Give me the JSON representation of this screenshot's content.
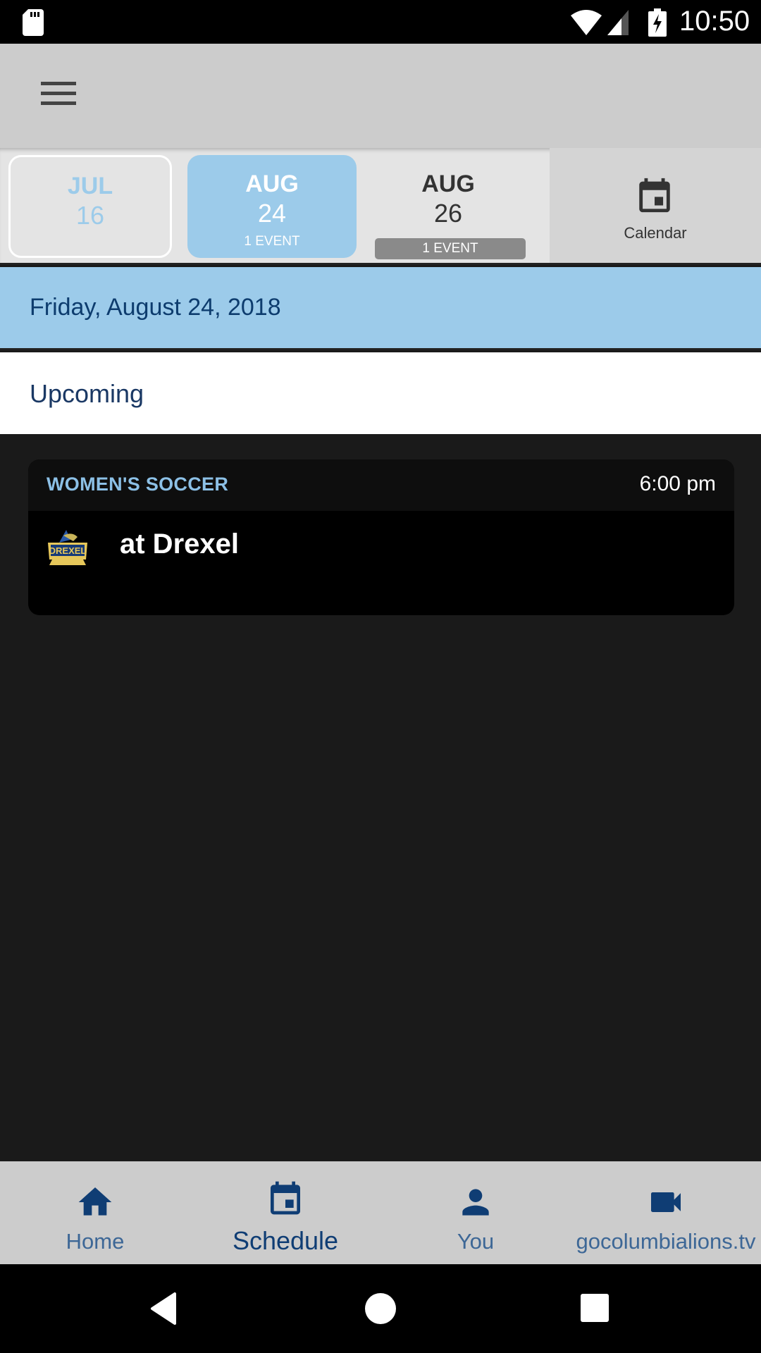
{
  "status_bar": {
    "time": "10:50",
    "icons": [
      "sd-card-icon",
      "wifi-icon",
      "cell-signal-icon",
      "battery-charging-icon"
    ]
  },
  "app_bar": {
    "menu_icon": "hamburger-menu-icon"
  },
  "date_strip": {
    "dates": [
      {
        "month": "JUL",
        "day": "16",
        "events": "",
        "state": "outlined"
      },
      {
        "month": "AUG",
        "day": "24",
        "events": "1 EVENT",
        "state": "selected"
      },
      {
        "month": "AUG",
        "day": "26",
        "events": "1 EVENT",
        "state": "default"
      }
    ],
    "calendar_label": "Calendar",
    "calendar_icon": "calendar-icon"
  },
  "date_header": "Friday, August 24, 2018",
  "section_label": "Upcoming",
  "events": [
    {
      "sport": "WOMEN'S SOCCER",
      "time": "6:00 pm",
      "opponent": "at Drexel",
      "logo": "drexel-dragons-logo"
    }
  ],
  "bottom_nav": {
    "items": [
      {
        "label": "Home",
        "icon": "home-icon",
        "active": false
      },
      {
        "label": "Schedule",
        "icon": "calendar-icon",
        "active": true
      },
      {
        "label": "You",
        "icon": "person-icon",
        "active": false
      },
      {
        "label": "gocolumbialions.tv",
        "icon": "video-camera-icon",
        "active": false
      }
    ]
  },
  "colors": {
    "accent_light_blue": "#9ccbea",
    "navy": "#0f3d74",
    "app_bar_gray": "#cccccc",
    "content_dark": "#1a1a1a"
  }
}
